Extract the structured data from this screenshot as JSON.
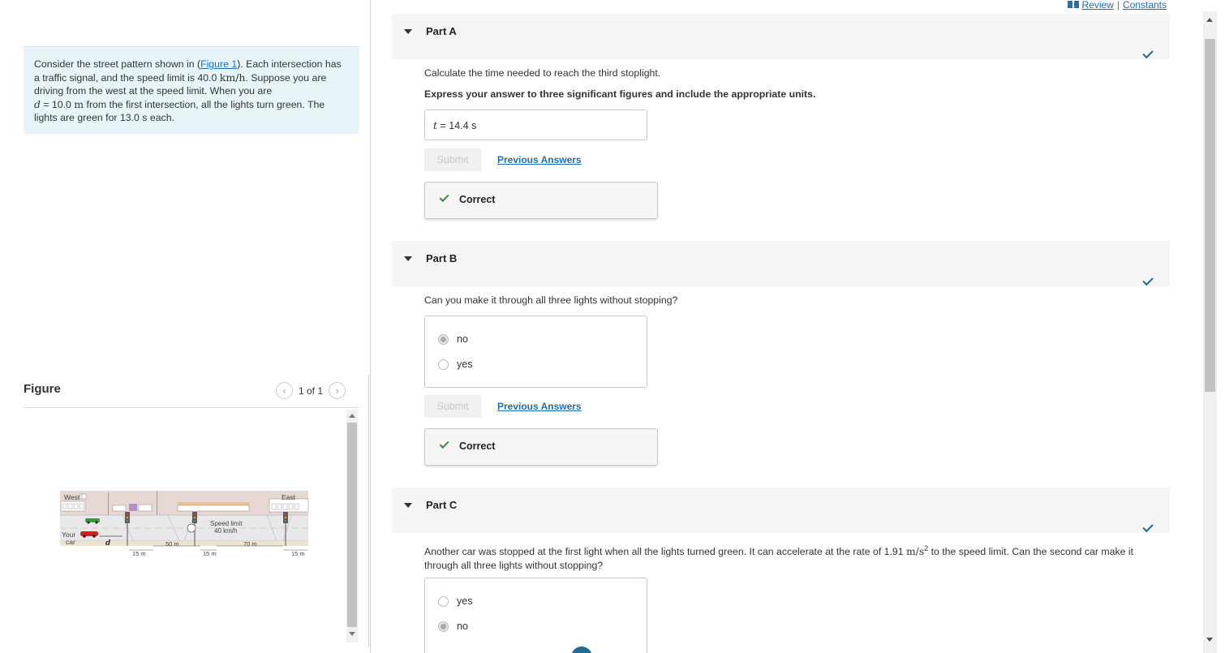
{
  "links": {
    "review": "Review",
    "sep": "|",
    "constants": "Constants"
  },
  "intro": {
    "t1": "Consider the street pattern shown in (",
    "figure_link": "Figure 1",
    "t2": "). Each intersection has a traffic signal, and the speed limit is 40.0 ",
    "unit_speed": "km/h",
    "t3": ". Suppose you are driving from the west at the speed limit. When you are ",
    "var_d": "d",
    "t4": " = 10.0 ",
    "unit_m": "m",
    "t5": " from the first intersection, all the lights turn green. The lights are green for 13.0 s each."
  },
  "figure": {
    "title": "Figure",
    "pager": "1 of 1",
    "labels": {
      "west": "West",
      "east": "East",
      "your": "Your",
      "car": "car",
      "d": "d",
      "d15a": "15 m",
      "d50": "50 m",
      "d15b": "15 m",
      "d70": "70 m",
      "d15c": "15 m",
      "speed1": "Speed limit",
      "speed2": "40 km/h"
    }
  },
  "partA": {
    "title": "Part A",
    "question": "Calculate the time needed to reach the third stoplight.",
    "instruction": "Express your answer to three significant figures and include the appropriate units.",
    "var": "t",
    "answer": " =  14.4 s",
    "submit": "Submit",
    "prev": "Previous Answers",
    "result": "Correct"
  },
  "partB": {
    "title": "Part B",
    "question": "Can you make it through all three lights without stopping?",
    "options": [
      "no",
      "yes"
    ],
    "selected": 0,
    "submit": "Submit",
    "prev": "Previous Answers",
    "result": "Correct"
  },
  "partC": {
    "title": "Part C",
    "q1": "Another car was stopped at the first light when all the lights turned green. It can accelerate at the rate of 1.91 ",
    "unit_acc": "m/s",
    "sup": "2",
    "q2": " to the speed limit. Can the second car make it through all three lights without stopping?",
    "options": [
      "yes",
      "no"
    ],
    "selected": 1
  },
  "colors": {
    "accent": "#1f6c8e",
    "correct_green": "#3a8c3a",
    "intro_bg": "#e8f5f8"
  }
}
